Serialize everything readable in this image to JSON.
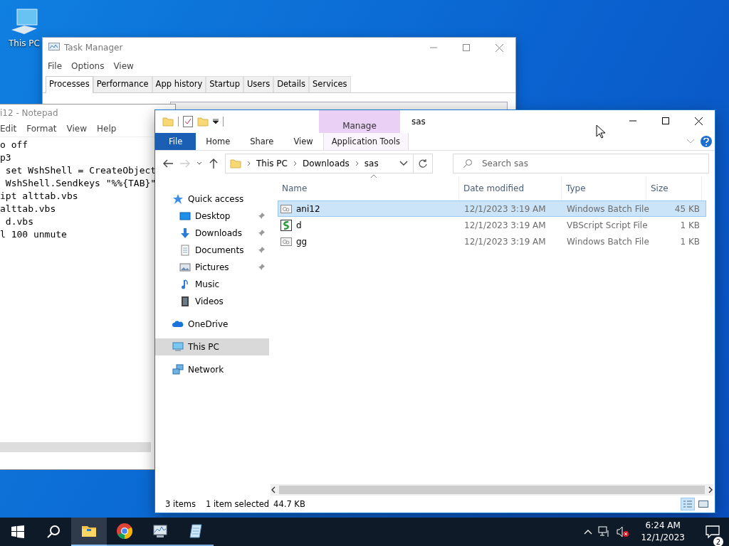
{
  "desktop_icons": [
    {
      "label": "This PC"
    }
  ],
  "task_manager": {
    "title": "Task Manager",
    "menu": [
      "File",
      "Options",
      "View"
    ],
    "tabs": [
      {
        "label": "Processes",
        "selected": true
      },
      {
        "label": "Performance",
        "selected": false
      },
      {
        "label": "App history",
        "selected": false
      },
      {
        "label": "Startup",
        "selected": false
      },
      {
        "label": "Users",
        "selected": false
      },
      {
        "label": "Details",
        "selected": false
      },
      {
        "label": "Services",
        "selected": false
      }
    ]
  },
  "notepad": {
    "title": "i12 - Notepad",
    "menu": [
      "Edit",
      "Format",
      "View",
      "Help"
    ],
    "lines": [
      "o off",
      "p3",
      " set WshShell = CreateObject",
      " WshShell.Sendkeys \"%%{TAB}\"",
      "ipt alttab.vbs",
      "alttab.vbs",
      " d.vbs",
      "l 100 unmute"
    ]
  },
  "explorer": {
    "title": "sas",
    "context_header": "Manage",
    "ribbon_tabs": [
      {
        "label": "File",
        "kind": "file"
      },
      {
        "label": "Home",
        "kind": "tab"
      },
      {
        "label": "Share",
        "kind": "tab"
      },
      {
        "label": "View",
        "kind": "tab"
      },
      {
        "label": "Application Tools",
        "kind": "context"
      }
    ],
    "breadcrumb": [
      "This PC",
      "Downloads",
      "sas"
    ],
    "search": {
      "placeholder": "Search sas"
    },
    "nav": [
      {
        "label": "Quick access",
        "kind": "star",
        "selected": false,
        "children": [
          {
            "label": "Desktop",
            "kind": "desktop",
            "pinned": true,
            "selected": false
          },
          {
            "label": "Downloads",
            "kind": "downloads",
            "pinned": true,
            "selected": false
          },
          {
            "label": "Documents",
            "kind": "documents",
            "pinned": true,
            "selected": false
          },
          {
            "label": "Pictures",
            "kind": "pictures",
            "pinned": true,
            "selected": false
          },
          {
            "label": "Music",
            "kind": "music",
            "pinned": false,
            "selected": false
          },
          {
            "label": "Videos",
            "kind": "videos",
            "pinned": false,
            "selected": false
          }
        ]
      },
      {
        "label": "OneDrive",
        "kind": "cloud",
        "selected": false
      },
      {
        "label": "This PC",
        "kind": "pc",
        "selected": true
      },
      {
        "label": "Network",
        "kind": "network",
        "selected": false
      }
    ],
    "columns": [
      "Name",
      "Date modified",
      "Type",
      "Size"
    ],
    "rows": [
      {
        "name": "ani12",
        "date": "12/1/2023 3:19 AM",
        "type": "Windows Batch File",
        "size": "45 KB",
        "kind": "batch",
        "selected": true
      },
      {
        "name": "d",
        "date": "12/1/2023 3:19 AM",
        "type": "VBScript Script File",
        "size": "1 KB",
        "kind": "script",
        "selected": false
      },
      {
        "name": "gg",
        "date": "12/1/2023 3:19 AM",
        "type": "Windows Batch File",
        "size": "1 KB",
        "kind": "batch",
        "selected": false
      }
    ],
    "status": {
      "count": "3 items",
      "selection": "1 item selected",
      "selection_size": "44.7 KB"
    }
  },
  "taskbar": {
    "apps": [
      {
        "kind": "explorer",
        "active": true
      },
      {
        "kind": "chrome",
        "active": false
      },
      {
        "kind": "taskmanager",
        "active": false
      },
      {
        "kind": "notepad",
        "active": false
      }
    ],
    "time": "6:24 AM",
    "date": "12/1/2023",
    "notifications": "2"
  }
}
